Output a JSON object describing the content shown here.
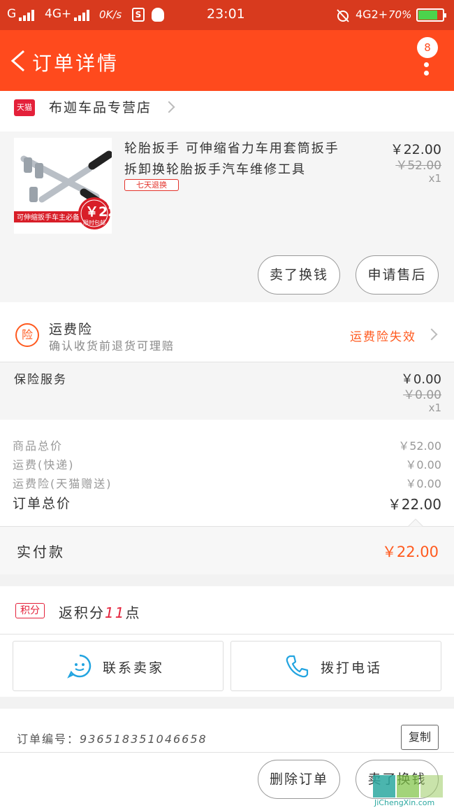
{
  "status_bar": {
    "carrier1": "G",
    "carrier2": "4G+",
    "speed": "0K/s",
    "s_icon": "S",
    "time": "23:01",
    "net2": "4G2+",
    "battery": "70%",
    "icons": [
      "signal-icon",
      "s-app-icon",
      "qq-icon",
      "alarm-off-icon",
      "battery-icon"
    ]
  },
  "header": {
    "title": "订单详情",
    "badge_count": "8",
    "accent_color": "#ff4a1d"
  },
  "store": {
    "badge": "天猫",
    "name": "布迦车品专营店"
  },
  "product": {
    "title": "轮胎扳手 可伸缩省力车用套筒扳手 拆卸换轮胎扳手汽车维修工具",
    "tag": "七天退换",
    "price": "￥22.00",
    "original_price": "￥52.00",
    "quantity": "x1",
    "image_caption1": "可伸缩扳手",
    "image_caption2": "车主必备",
    "image_price": "￥22",
    "image_promo": "限时包邮"
  },
  "actions_top": {
    "sell_label": "卖了换钱",
    "after_sale_label": "申请售后"
  },
  "insurance": {
    "icon_char": "险",
    "title": "运费险",
    "subtitle": "确认收货前退货可理赔",
    "status": "运费险失效"
  },
  "service": {
    "label": "保险服务",
    "price": "￥0.00",
    "original_price": "￥0.00",
    "quantity": "x1"
  },
  "summary": {
    "rows": [
      {
        "label": "商品总价",
        "value": "￥52.00"
      },
      {
        "label": "运费(快递)",
        "value": "￥0.00"
      },
      {
        "label": "运费险(天猫赠送)",
        "value": "￥0.00"
      }
    ],
    "total_label": "订单总价",
    "total_value": "￥22.00"
  },
  "payment": {
    "label": "实付款",
    "value": "￥22.00"
  },
  "points": {
    "badge": "积分",
    "prefix": "返积分",
    "count": "11",
    "suffix": "点"
  },
  "contact": {
    "seller_label": "联系卖家",
    "phone_label": "拨打电话"
  },
  "order": {
    "number_label": "订单编号：",
    "number": "936518351046658",
    "copy_label": "复制"
  },
  "actions_bottom": {
    "delete_label": "删除订单",
    "sell_label": "卖了换钱"
  },
  "watermark": {
    "text": "JiChengXin.com"
  }
}
